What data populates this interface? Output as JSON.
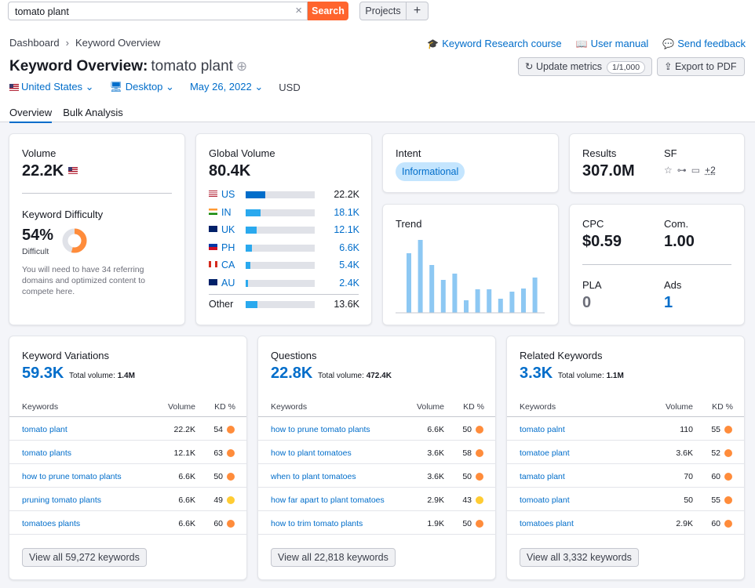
{
  "search": {
    "value": "tomato plant",
    "button": "Search"
  },
  "topbar": {
    "projects": "Projects",
    "add": "+"
  },
  "breadcrumb": {
    "dashboard": "Dashboard",
    "current": "Keyword Overview"
  },
  "header_links": {
    "course": "Keyword Research course",
    "manual": "User manual",
    "feedback": "Send feedback"
  },
  "title": {
    "prefix": "Keyword Overview:",
    "keyword": "tomato plant"
  },
  "actions": {
    "update": "Update metrics",
    "update_badge": "1/1,000",
    "export": "Export to PDF"
  },
  "filters": {
    "country": "United States",
    "device": "Desktop",
    "date": "May 26, 2022",
    "currency": "USD"
  },
  "tabs": {
    "overview": "Overview",
    "bulk": "Bulk Analysis"
  },
  "volume": {
    "label": "Volume",
    "value": "22.2K"
  },
  "difficulty": {
    "label": "Keyword Difficulty",
    "value": "54%",
    "level": "Difficult",
    "percent": 54,
    "note": "You will need to have 34 referring domains and optimized content to compete here."
  },
  "global_volume": {
    "label": "Global Volume",
    "value": "80.4K",
    "rows": [
      {
        "code": "US",
        "value": "22.2K",
        "fraction": 0.28
      },
      {
        "code": "IN",
        "value": "18.1K",
        "fraction": 0.22
      },
      {
        "code": "UK",
        "value": "12.1K",
        "fraction": 0.16
      },
      {
        "code": "PH",
        "value": "6.6K",
        "fraction": 0.09
      },
      {
        "code": "CA",
        "value": "5.4K",
        "fraction": 0.07
      },
      {
        "code": "AU",
        "value": "2.4K",
        "fraction": 0.03
      }
    ],
    "other_label": "Other",
    "other_value": "13.6K",
    "other_fraction": 0.17
  },
  "intent": {
    "label": "Intent",
    "value": "Informational"
  },
  "trend": {
    "label": "Trend",
    "values": [
      0.76,
      0.93,
      0.61,
      0.42,
      0.5,
      0.16,
      0.3,
      0.3,
      0.18,
      0.27,
      0.31,
      0.45
    ]
  },
  "results": {
    "label": "Results",
    "value": "307.0M",
    "sf_label": "SF",
    "sf_more": "+2"
  },
  "cpc": {
    "label": "CPC",
    "value": "$0.59",
    "com_label": "Com.",
    "com_value": "1.00",
    "pla_label": "PLA",
    "pla_value": "0",
    "ads_label": "Ads",
    "ads_value": "1"
  },
  "colors": {
    "accent": "#006dca",
    "orange": "#ff642d",
    "kd_orange": "#ff8c3b",
    "kd_yellow": "#ffcc33"
  },
  "variations": {
    "title": "Keyword Variations",
    "count": "59.3K",
    "total_label": "Total volume:",
    "total": "1.4M",
    "col_kw": "Keywords",
    "col_vol": "Volume",
    "col_kd": "KD %",
    "rows": [
      {
        "keyword": "tomato plant",
        "volume": "22.2K",
        "kd": "54",
        "color": "#ff8c3b"
      },
      {
        "keyword": "tomato plants",
        "volume": "12.1K",
        "kd": "63",
        "color": "#ff8c3b"
      },
      {
        "keyword": "how to prune tomato plants",
        "volume": "6.6K",
        "kd": "50",
        "color": "#ff8c3b"
      },
      {
        "keyword": "pruning tomato plants",
        "volume": "6.6K",
        "kd": "49",
        "color": "#ffcc33"
      },
      {
        "keyword": "tomatoes plants",
        "volume": "6.6K",
        "kd": "60",
        "color": "#ff8c3b"
      }
    ],
    "view_all": "View all 59,272 keywords"
  },
  "questions": {
    "title": "Questions",
    "count": "22.8K",
    "total_label": "Total volume:",
    "total": "472.4K",
    "col_kw": "Keywords",
    "col_vol": "Volume",
    "col_kd": "KD %",
    "rows": [
      {
        "keyword": "how to prune tomato plants",
        "volume": "6.6K",
        "kd": "50",
        "color": "#ff8c3b"
      },
      {
        "keyword": "how to plant tomatoes",
        "volume": "3.6K",
        "kd": "58",
        "color": "#ff8c3b"
      },
      {
        "keyword": "when to plant tomatoes",
        "volume": "3.6K",
        "kd": "50",
        "color": "#ff8c3b"
      },
      {
        "keyword": "how far apart to plant tomatoes",
        "volume": "2.9K",
        "kd": "43",
        "color": "#ffcc33"
      },
      {
        "keyword": "how to trim tomato plants",
        "volume": "1.9K",
        "kd": "50",
        "color": "#ff8c3b"
      }
    ],
    "view_all": "View all 22,818 keywords"
  },
  "related": {
    "title": "Related Keywords",
    "count": "3.3K",
    "total_label": "Total volume:",
    "total": "1.1M",
    "col_kw": "Keywords",
    "col_vol": "Volume",
    "col_kd": "KD %",
    "rows": [
      {
        "keyword": "tomato palnt",
        "volume": "110",
        "kd": "55",
        "color": "#ff8c3b"
      },
      {
        "keyword": "tomatoe plant",
        "volume": "3.6K",
        "kd": "52",
        "color": "#ff8c3b"
      },
      {
        "keyword": "tamato plant",
        "volume": "70",
        "kd": "60",
        "color": "#ff8c3b"
      },
      {
        "keyword": "tomoato plant",
        "volume": "50",
        "kd": "55",
        "color": "#ff8c3b"
      },
      {
        "keyword": "tomatoes plant",
        "volume": "2.9K",
        "kd": "60",
        "color": "#ff8c3b"
      }
    ],
    "view_all": "View all 3,332 keywords"
  }
}
